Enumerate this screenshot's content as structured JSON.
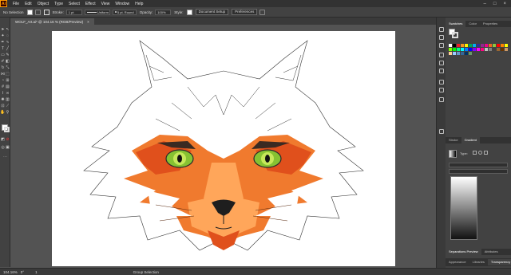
{
  "menubar": {
    "logo": "Ai",
    "items": [
      "File",
      "Edit",
      "Object",
      "Type",
      "Select",
      "Effect",
      "View",
      "Window",
      "Help"
    ]
  },
  "controlbar": {
    "selection": "No Selection",
    "stroke_label": "Stroke:",
    "stroke_value": "1 pt",
    "profile": "Uniform",
    "brush": "5 pt. Round",
    "opacity_label": "Opacity:",
    "opacity_value": "100%",
    "style_label": "Style:",
    "doc_setup": "Document Setup",
    "preferences": "Preferences"
  },
  "document": {
    "tab_title": "WOLF_Art.ai* @ 104.16 % (RGB/Preview)",
    "close_glyph": "×"
  },
  "statusbar": {
    "zoom": "104.16%",
    "angle": "0°",
    "page": "1",
    "tool": "Group Selection"
  },
  "panels": {
    "top_tabs": [
      "Swatches",
      "Color",
      "Properties"
    ],
    "mid_tabs": [
      "Stroke",
      "Gradient"
    ],
    "gradient_type_label": "Type:",
    "bottom_tabs": [
      "Appearance",
      "Libraries",
      "Transparency"
    ],
    "separations_label": "Separations Preview",
    "attributes_label": "Attributes"
  },
  "colors": {
    "menubar_bg": "#323232",
    "panel_bg": "#424242",
    "canvas_bg": "#535353",
    "artboard": "#ffffff",
    "accent_orange": "#ff9a00",
    "wolf_orange": "#f07a2e",
    "wolf_dark_orange": "#e0501c",
    "wolf_light_orange": "#ffa65a",
    "eye_green": "#86c232"
  },
  "swatches": [
    "#ffffff",
    "#000000",
    "#ed1c24",
    "#f7941d",
    "#fff200",
    "#00a651",
    "#00aeef",
    "#2e3192",
    "#92278f",
    "#ec008c",
    "#f26522",
    "#8dc63f",
    "#ff0000",
    "#ff8000",
    "#ffff00",
    "#80ff00",
    "#00ff00",
    "#00ff80",
    "#00ffff",
    "#0080ff",
    "#0000ff",
    "#8000ff",
    "#ff00ff",
    "#ff0080",
    "#c0c0c0",
    "#808080",
    "#404040",
    "#996633",
    "#663300",
    "#cc9966",
    "#ffcc99",
    "#99ccff",
    "#6699cc",
    "#336699",
    "#003366",
    "#669966"
  ]
}
